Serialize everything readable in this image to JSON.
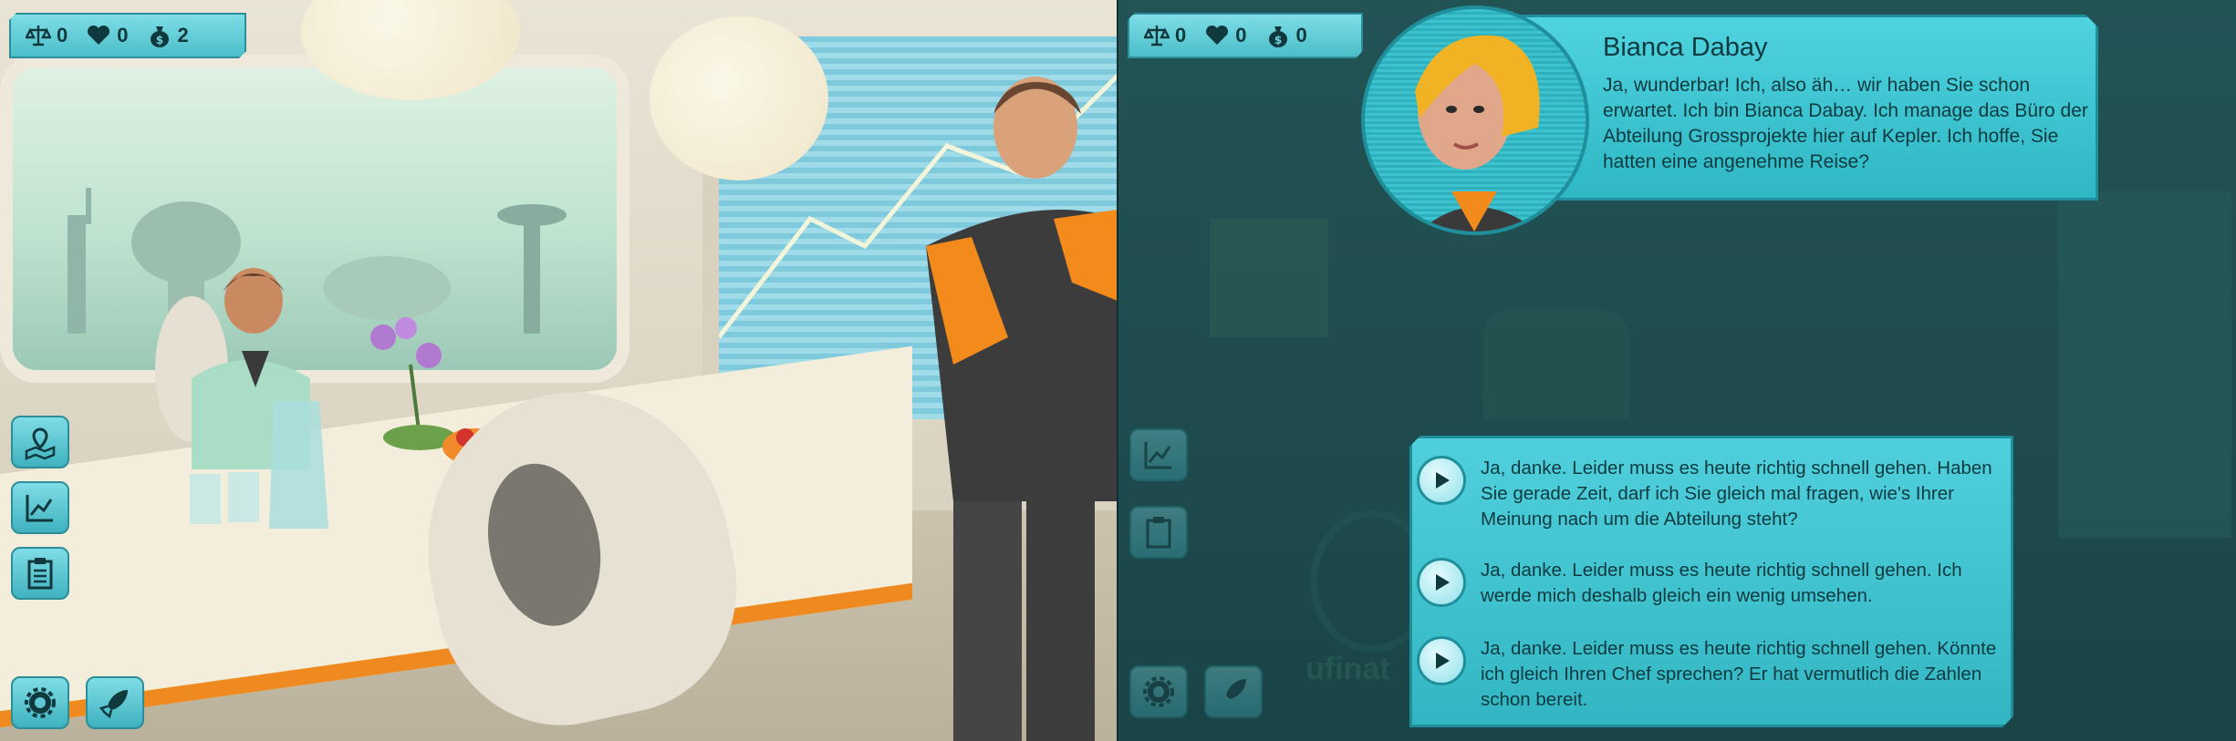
{
  "left_panel": {
    "hud": {
      "balance_count": "0",
      "heart_count": "0",
      "money_count": "2"
    },
    "side_buttons": [
      "map-icon",
      "chart-icon",
      "clipboard-icon"
    ],
    "bottom_buttons": [
      "gear-icon",
      "rocket-icon"
    ]
  },
  "right_panel": {
    "hud": {
      "balance_count": "0",
      "heart_count": "0",
      "money_count": "0"
    },
    "speaker": {
      "name": "Bianca Dabay",
      "text": "Ja, wunderbar! Ich, also äh… wir haben Sie schon erwartet. Ich bin Bianca Dabay. Ich manage das Büro der Abteilung Grossprojekte hier auf Kepler. Ich hoffe, Sie hatten eine angenehme Reise?"
    },
    "answers": [
      {
        "text": "Ja, danke. Leider muss es heute richtig schnell gehen. Haben Sie gerade Zeit, darf ich Sie gleich mal fragen, wie's Ihrer Meinung nach um die Abteilung steht?"
      },
      {
        "text": "Ja, danke. Leider muss es heute richtig schnell gehen. Ich werde mich deshalb gleich ein wenig umsehen."
      },
      {
        "text": "Ja, danke. Leider muss es heute richtig schnell gehen. Könnte ich gleich Ihren Chef sprechen? Er hat vermutlich die Zahlen schon bereit."
      }
    ],
    "background_logo_text": "ufinat"
  },
  "colors": {
    "hud_cyan": "#4bbfca",
    "accent_orange": "#ef8a20",
    "dark_teal": "#1f8f9b"
  }
}
